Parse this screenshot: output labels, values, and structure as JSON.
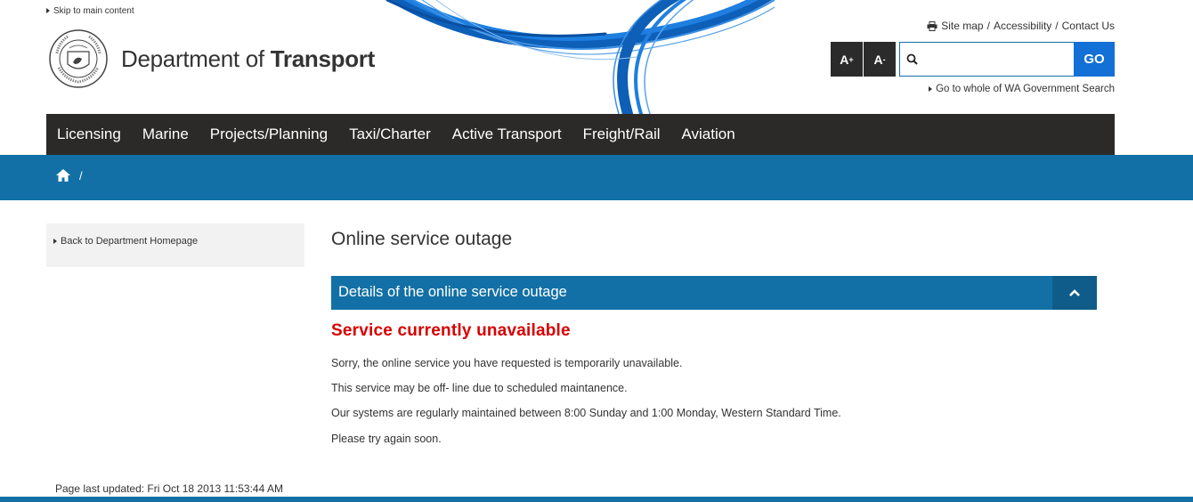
{
  "header": {
    "skip_link": "Skip to main content",
    "dept_prefix": "Department of ",
    "dept_bold": "Transport",
    "utility_links": [
      "Site map",
      "Accessibility",
      "Contact Us"
    ],
    "utility_sep": "/",
    "font_increase": "A",
    "font_increase_sup": "+",
    "font_decrease": "A",
    "font_decrease_sup": "-",
    "search_placeholder": "",
    "go_label": "GO",
    "wa_search_link": "Go to whole of WA Government Search"
  },
  "nav": {
    "items": [
      "Licensing",
      "Marine",
      "Projects/Planning",
      "Taxi/Charter",
      "Active Transport",
      "Freight/Rail",
      "Aviation"
    ]
  },
  "breadcrumb": {
    "separator": "/"
  },
  "sidebar": {
    "back_link": "Back to Department Homepage"
  },
  "main": {
    "title": "Online service outage",
    "accordion_title": "Details of the online service outage",
    "alert": "Service currently unavailable",
    "paragraphs": [
      "Sorry, the online service you have requested is temporarily unavailable.",
      "This service may be off- line due to scheduled maintanence.",
      "Our systems are regularly maintained between 8:00 Sunday and 1:00 Monday, Western Standard Time.",
      "Please try again soon."
    ]
  },
  "footer": {
    "last_updated": "Page last updated: Fri Oct 18 2013 11:53:44 AM"
  },
  "colors": {
    "brand_blue": "#1270a6",
    "nav_dark": "#2b2a29",
    "alert_red": "#d70000",
    "go_blue": "#1270d6"
  }
}
